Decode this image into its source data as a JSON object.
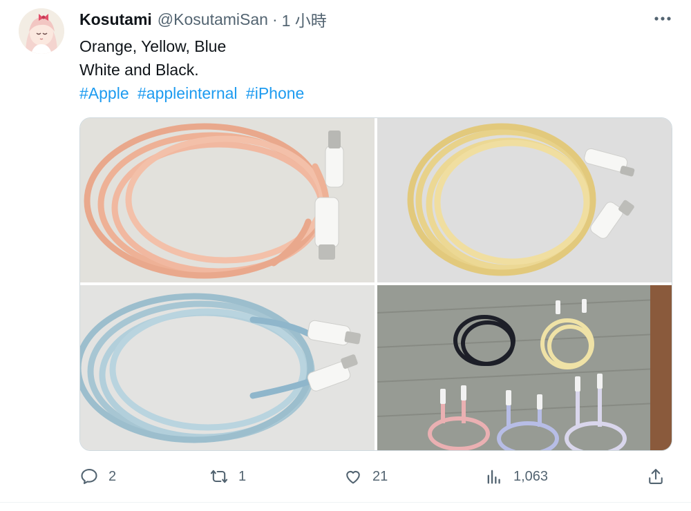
{
  "tweet": {
    "author_name": "Kosutami",
    "author_handle": "@KosutamiSan",
    "separator": "·",
    "time": "1 小時",
    "text_lines": [
      "Orange, Yellow, Blue",
      "White and Black."
    ],
    "hashtags": [
      "#Apple",
      "#appleinternal",
      "#iPhone"
    ],
    "counts": {
      "replies": "2",
      "retweets": "1",
      "likes": "21",
      "views": "1,063"
    }
  },
  "icons": {
    "more": "more-horizontal-icon",
    "reply": "reply-icon",
    "retweet": "retweet-icon",
    "like": "heart-icon",
    "views": "views-chart-icon",
    "share": "share-icon"
  },
  "colors": {
    "text": "#0f1419",
    "secondary": "#536471",
    "link": "#1d9bf0",
    "border": "#cfd9de",
    "cable_orange": "#efb39a",
    "cable_yellow": "#ead58b",
    "cable_blue": "#a7c6d3"
  }
}
